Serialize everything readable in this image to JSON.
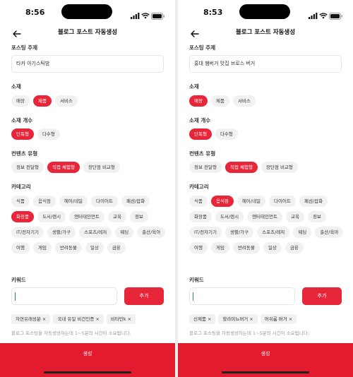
{
  "screens": [
    {
      "status": {
        "time": "8:56"
      },
      "nav": {
        "title": "블로그 포스트 자동생성"
      },
      "topic": {
        "label": "포스팅 주제",
        "value": "타카 아기스틱밤"
      },
      "material": {
        "label": "소재",
        "chips": [
          {
            "text": "매장",
            "selected": false
          },
          {
            "text": "제품",
            "selected": true
          },
          {
            "text": "서비스",
            "selected": false
          }
        ]
      },
      "count": {
        "label": "소재 개수",
        "chips": [
          {
            "text": "단독형",
            "selected": true
          },
          {
            "text": "다수형",
            "selected": false
          }
        ]
      },
      "content_type": {
        "label": "컨텐츠 유형",
        "chips": [
          {
            "text": "정보 전달형",
            "selected": false
          },
          {
            "text": "직접 체험형",
            "selected": true
          },
          {
            "text": "장단점 비교형",
            "selected": false
          }
        ]
      },
      "category": {
        "label": "카테고리",
        "chips": [
          {
            "text": "식품",
            "selected": false
          },
          {
            "text": "음식점",
            "selected": false
          },
          {
            "text": "헤어/네일",
            "selected": false
          },
          {
            "text": "다이어트",
            "selected": false
          },
          {
            "text": "패션/잡화",
            "selected": false
          },
          {
            "text": "화장품",
            "selected": true
          },
          {
            "text": "도서/렌시",
            "selected": false
          },
          {
            "text": "엔터테인먼트",
            "selected": false
          },
          {
            "text": "교육",
            "selected": false
          },
          {
            "text": "정보",
            "selected": false
          },
          {
            "text": "IT/전자기기",
            "selected": false
          },
          {
            "text": "생활/가구",
            "selected": false
          },
          {
            "text": "스포츠/레저",
            "selected": false
          },
          {
            "text": "웨딩",
            "selected": false
          },
          {
            "text": "출산/육아",
            "selected": false
          },
          {
            "text": "여행",
            "selected": false
          },
          {
            "text": "게임",
            "selected": false
          },
          {
            "text": "반려동물",
            "selected": false
          },
          {
            "text": "일상",
            "selected": false
          },
          {
            "text": "금융",
            "selected": false
          }
        ]
      },
      "keyword": {
        "label": "키워드",
        "add_label": "추가",
        "tags": [
          "자연유래성분",
          "국내 유일 비건인증",
          "비타민k"
        ]
      },
      "note": "블로그 포스팅을 자동생성하는데 1~5분의 시간이 소요됩니다.",
      "generate_label": "생성"
    },
    {
      "status": {
        "time": "8:53"
      },
      "nav": {
        "title": "블로그 포스트 자동생성"
      },
      "topic": {
        "label": "포스팅 주제",
        "value": "홍대 햄버거 맛집 브로스 버거"
      },
      "material": {
        "label": "소재",
        "chips": [
          {
            "text": "매장",
            "selected": true
          },
          {
            "text": "제품",
            "selected": false
          },
          {
            "text": "서비스",
            "selected": false
          }
        ]
      },
      "count": {
        "label": "소재 개수",
        "chips": [
          {
            "text": "단독형",
            "selected": true
          },
          {
            "text": "다수형",
            "selected": false
          }
        ]
      },
      "content_type": {
        "label": "컨텐츠 유형",
        "chips": [
          {
            "text": "정보 전달형",
            "selected": false
          },
          {
            "text": "직접 체험형",
            "selected": true
          },
          {
            "text": "장단점 비교형",
            "selected": false
          }
        ]
      },
      "category": {
        "label": "카테고리",
        "chips": [
          {
            "text": "식품",
            "selected": false
          },
          {
            "text": "음식점",
            "selected": true
          },
          {
            "text": "헤어/네일",
            "selected": false
          },
          {
            "text": "다이어트",
            "selected": false
          },
          {
            "text": "패션/잡화",
            "selected": false
          },
          {
            "text": "화장품",
            "selected": false
          },
          {
            "text": "도서/렌시",
            "selected": false
          },
          {
            "text": "엔터테인먼트",
            "selected": false
          },
          {
            "text": "교육",
            "selected": false
          },
          {
            "text": "정보",
            "selected": false
          },
          {
            "text": "IT/전자기기",
            "selected": false
          },
          {
            "text": "생활/가구",
            "selected": false
          },
          {
            "text": "스포츠/레저",
            "selected": false
          },
          {
            "text": "웨딩",
            "selected": false
          },
          {
            "text": "출산/육아",
            "selected": false
          },
          {
            "text": "여행",
            "selected": false
          },
          {
            "text": "게임",
            "selected": false
          },
          {
            "text": "반려동물",
            "selected": false
          },
          {
            "text": "일상",
            "selected": false
          },
          {
            "text": "금융",
            "selected": false
          }
        ]
      },
      "keyword": {
        "label": "키워드",
        "add_label": "추가",
        "tags": [
          "신제품",
          "할라피뇨버거",
          "머쉬룸 버거"
        ]
      },
      "note": "블로그 포스팅을 자동생성하는데 1~5분의 시간이 소요됩니다.",
      "generate_label": "생성"
    }
  ],
  "colors": {
    "accent": "#e8263a",
    "chip_bg": "#f1f1f1"
  }
}
